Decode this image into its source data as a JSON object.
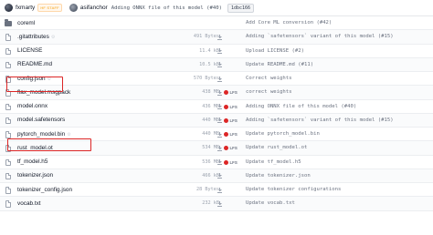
{
  "header": {
    "user1": "fxmarty",
    "staff_badge": "HF STAFF",
    "user2": "asifanchor",
    "commit_message": "Adding ONNX file of this model (#40)",
    "commit_hash": "1dbc166"
  },
  "files": [
    {
      "type": "folder",
      "name": "coreml",
      "gear": false,
      "size": "",
      "lfs": false,
      "message": "Add Core ML conversion (#42)"
    },
    {
      "type": "file",
      "name": ".gitattributes",
      "gear": true,
      "size": "491 Bytes",
      "lfs": false,
      "message": "Adding `safetensors` variant of this model (#15)"
    },
    {
      "type": "file",
      "name": "LICENSE",
      "gear": false,
      "size": "11.4 kB",
      "lfs": false,
      "message": "Upload LICENSE (#2)"
    },
    {
      "type": "file",
      "name": "README.md",
      "gear": false,
      "size": "10.5 kB",
      "lfs": false,
      "message": "Update README.md (#11)"
    },
    {
      "type": "file",
      "name": "config.json",
      "gear": true,
      "size": "570 Bytes",
      "lfs": false,
      "message": "Correct weights"
    },
    {
      "type": "file",
      "name": "flax_model.msgpack",
      "gear": false,
      "size": "438 MB",
      "lfs": true,
      "message": "correct weights"
    },
    {
      "type": "file",
      "name": "model.onnx",
      "gear": false,
      "size": "436 MB",
      "lfs": true,
      "message": "Adding ONNX file of this model (#40)"
    },
    {
      "type": "file",
      "name": "model.safetensors",
      "gear": false,
      "size": "440 MB",
      "lfs": true,
      "message": "Adding `safetensors` variant of this model (#15)"
    },
    {
      "type": "file",
      "name": "pytorch_model.bin",
      "gear": true,
      "size": "440 MB",
      "lfs": true,
      "message": "Update pytorch_model.bin"
    },
    {
      "type": "file",
      "name": "rust_model.ot",
      "gear": false,
      "size": "534 MB",
      "lfs": true,
      "message": "Update rust_model.ot"
    },
    {
      "type": "file",
      "name": "tf_model.h5",
      "gear": false,
      "size": "536 MB",
      "lfs": true,
      "message": "Update tf_model.h5"
    },
    {
      "type": "file",
      "name": "tokenizer.json",
      "gear": false,
      "size": "466 kB",
      "lfs": false,
      "message": "Update tokenizer.json"
    },
    {
      "type": "file",
      "name": "tokenizer_config.json",
      "gear": false,
      "size": "28 Bytes",
      "lfs": false,
      "message": "Update tokenizer configurations"
    },
    {
      "type": "file",
      "name": "vocab.txt",
      "gear": false,
      "size": "232 kB",
      "lfs": false,
      "message": "Update vocab.txt"
    }
  ],
  "lfs_label": "LFS",
  "highlight_color": "#dc2626"
}
